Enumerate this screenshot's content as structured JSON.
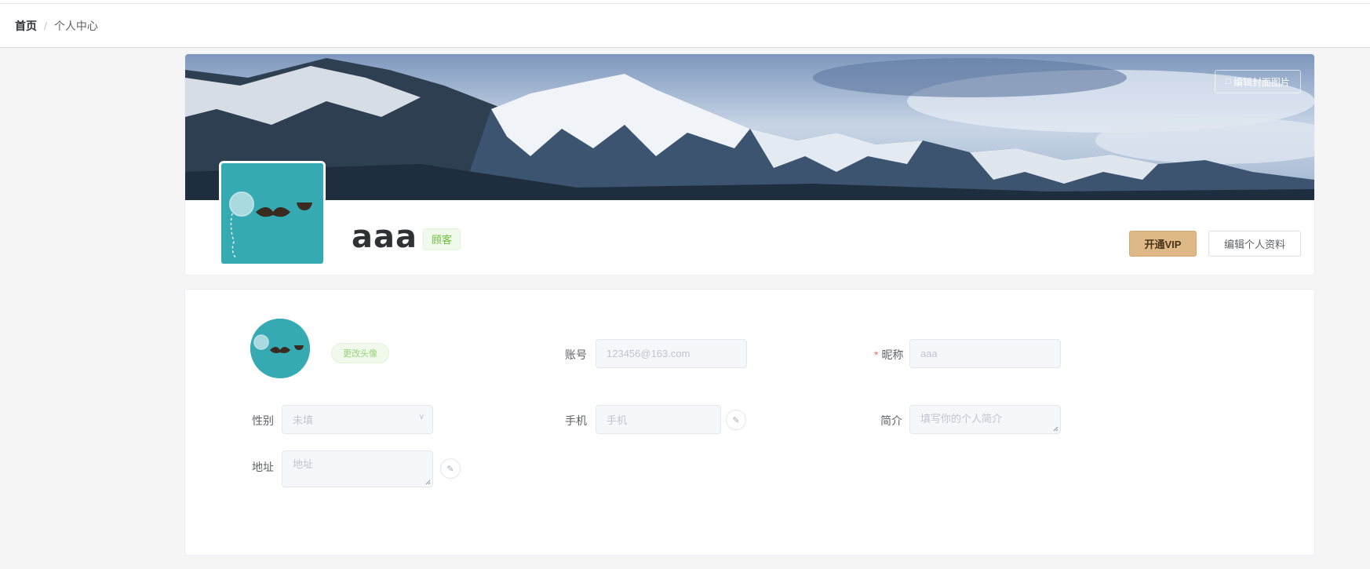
{
  "breadcrumb": {
    "home": "首页",
    "separator": "/",
    "current": "个人中心"
  },
  "profile": {
    "edit_cover_label": "编辑封面图片",
    "username": "aaa",
    "role_tag": "顾客",
    "vip_label": "开通VIP",
    "edit_profile_label": "编辑个人资料"
  },
  "form": {
    "change_avatar_label": "更改头像",
    "account": {
      "label": "账号",
      "value": "123456@163.com"
    },
    "nickname": {
      "required_mark": "*",
      "label": "昵称",
      "value": "aaa"
    },
    "gender": {
      "label": "性别",
      "value": "未填"
    },
    "phone": {
      "label": "手机",
      "placeholder": "手机"
    },
    "bio": {
      "label": "简介",
      "placeholder": "填写你的个人简介"
    },
    "address": {
      "label": "地址",
      "placeholder": "地址"
    }
  },
  "colors": {
    "vip_button": "#deb887",
    "tag_green_text": "#67c23a",
    "avatar_bg": "#35aab2",
    "required": "#f56c6c"
  },
  "icons": [
    "camera-icon",
    "edit-pen-icon",
    "chevron-down-icon",
    "mustache-avatar-icon"
  ]
}
